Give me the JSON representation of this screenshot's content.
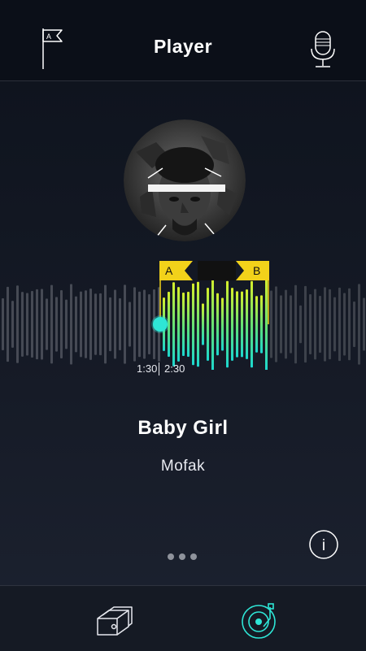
{
  "header": {
    "title": "Player"
  },
  "icons": {
    "left": "flag-a-icon",
    "right": "microphone-icon"
  },
  "loop": {
    "a_label": "A",
    "b_label": "B"
  },
  "playback": {
    "current": "1:30",
    "total": "2:30",
    "progress": 0.44
  },
  "track": {
    "title": "Baby Girl",
    "artist": "Mofak"
  },
  "info_label": "i",
  "pager": {
    "pages": 3
  },
  "tabbar": {
    "tabs": [
      "cards-icon",
      "turntable-icon"
    ],
    "active": "turntable-icon"
  },
  "colors": {
    "accent": "#2ee6d6",
    "loop_marker": "#f2d21a",
    "header_bg": "#0b0f18"
  }
}
